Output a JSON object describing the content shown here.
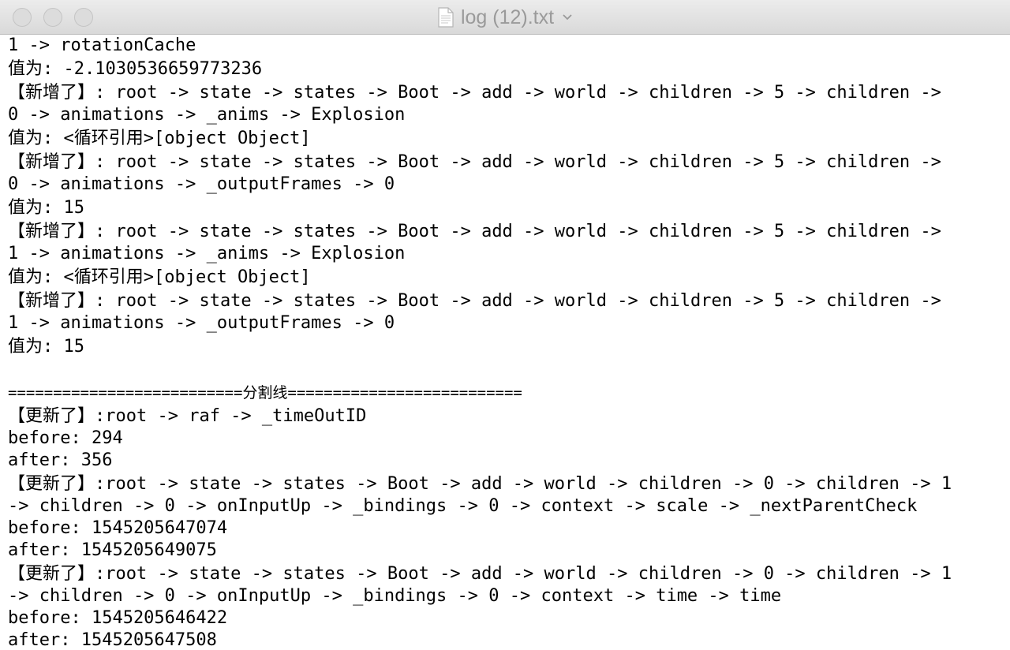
{
  "window": {
    "title": "log (12).txt",
    "icons": {
      "file": "document-icon",
      "menu": "chevron-down-icon"
    }
  },
  "log": {
    "lines": [
      "1 -> rotationCache",
      "值为: -2.1030536659773236",
      "【新增了】: root -> state -> states -> Boot -> add -> world -> children -> 5 -> children ->",
      "0 -> animations -> _anims -> Explosion",
      "值为: <循环引用>[object Object]",
      "【新增了】: root -> state -> states -> Boot -> add -> world -> children -> 5 -> children ->",
      "0 -> animations -> _outputFrames -> 0",
      "值为: 15",
      "【新增了】: root -> state -> states -> Boot -> add -> world -> children -> 5 -> children ->",
      "1 -> animations -> _anims -> Explosion",
      "值为: <循环引用>[object Object]",
      "【新增了】: root -> state -> states -> Boot -> add -> world -> children -> 5 -> children ->",
      "1 -> animations -> _outputFrames -> 0",
      "值为: 15"
    ],
    "divider": "==========================分割线==========================",
    "lines_after": [
      "【更新了】:root -> raf -> _timeOutID",
      "before: 294",
      "after: 356",
      "【更新了】:root -> state -> states -> Boot -> add -> world -> children -> 0 -> children -> 1",
      "-> children -> 0 -> onInputUp -> _bindings -> 0 -> context -> scale -> _nextParentCheck",
      "before: 1545205647074",
      "after: 1545205649075",
      "【更新了】:root -> state -> states -> Boot -> add -> world -> children -> 0 -> children -> 1",
      "-> children -> 0 -> onInputUp -> _bindings -> 0 -> context -> time -> time",
      "before: 1545205646422",
      "after: 1545205647508"
    ]
  }
}
